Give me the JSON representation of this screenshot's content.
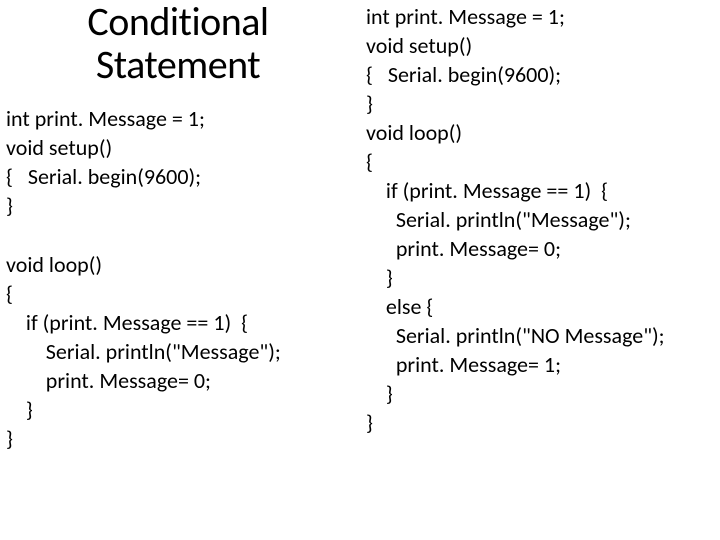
{
  "title_line1": "Conditional",
  "title_line2": "Statement",
  "left_code": "int print. Message = 1;\nvoid setup()\n{   Serial. begin(9600);\n}\n\nvoid loop()\n{\n    if (print. Message == 1)  {\n        Serial. println(\"Message\");\n        print. Message= 0;\n    }\n}",
  "right_code": "int print. Message = 1;\nvoid setup()\n{   Serial. begin(9600);\n}\nvoid loop()\n{\n    if (print. Message == 1)  {\n      Serial. println(\"Message\");\n      print. Message= 0;\n    }\n    else {\n      Serial. println(\"NO Message\");\n      print. Message= 1;\n    }\n}"
}
